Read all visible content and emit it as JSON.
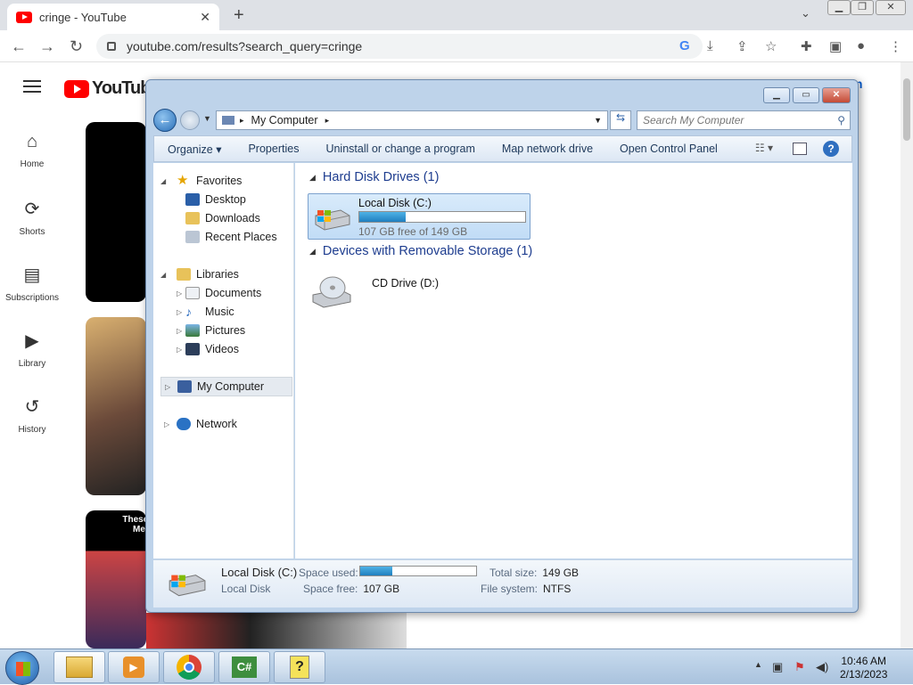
{
  "browser": {
    "tab_title": "cringe - YouTube",
    "tab_close": "✕",
    "new_tab": "+",
    "url": "youtube.com/results?search_query=cringe"
  },
  "youtube": {
    "logo_text": "YouTube",
    "sign_in": "in",
    "sidebar": [
      {
        "label": "Home",
        "icon": "⌂"
      },
      {
        "label": "Shorts",
        "icon": "⟳"
      },
      {
        "label": "Subscriptions",
        "icon": "▤"
      },
      {
        "label": "Library",
        "icon": "▶"
      },
      {
        "label": "History",
        "icon": "↺"
      }
    ],
    "thumb_caption_1": "These a",
    "thumb_caption_2": "Me"
  },
  "explorer": {
    "breadcrumb": "My Computer",
    "search_placeholder": "Search My Computer",
    "commands": [
      "Organize ▾",
      "Properties",
      "Uninstall or change a program",
      "Map network drive",
      "Open Control Panel"
    ],
    "nav": {
      "favorites": "Favorites",
      "desktop": "Desktop",
      "downloads": "Downloads",
      "recent": "Recent Places",
      "libraries": "Libraries",
      "documents": "Documents",
      "music": "Music",
      "pictures": "Pictures",
      "videos": "Videos",
      "my_computer": "My Computer",
      "network": "Network"
    },
    "groups": {
      "hdd": "Hard Disk Drives (1)",
      "removable": "Devices with Removable Storage (1)"
    },
    "drives": {
      "c_name": "Local Disk (C:)",
      "c_free": "107 GB free of 149 GB",
      "c_used_fraction": 0.28,
      "d_name": "CD Drive (D:)"
    },
    "details": {
      "name": "Local Disk (C:)",
      "type": "Local Disk",
      "space_used_label": "Space used:",
      "space_free_label": "Space free:",
      "space_free": "107 GB",
      "total_size_label": "Total size:",
      "total_size": "149 GB",
      "fs_label": "File system:",
      "fs": "NTFS"
    }
  },
  "taskbar": {
    "time": "10:46 AM",
    "date": "2/13/2023"
  }
}
